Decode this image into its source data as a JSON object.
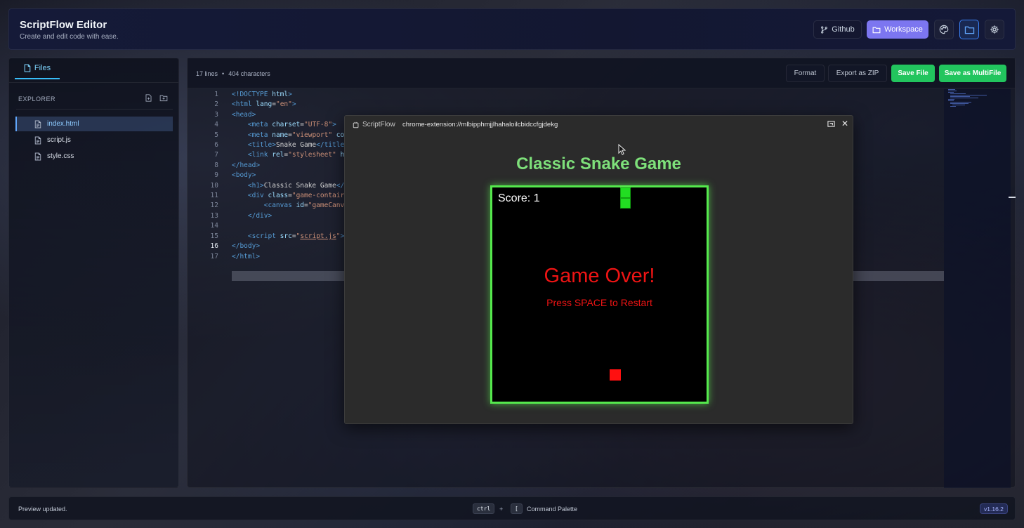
{
  "header": {
    "title": "ScriptFlow Editor",
    "subtitle": "Create and edit code with ease.",
    "github_label": "Github",
    "workspace_label": "Workspace",
    "accent_color": "#7c76f0"
  },
  "sidebar": {
    "tab_label": "Files",
    "explorer_label": "EXPLORER",
    "files": [
      {
        "name": "index.html",
        "active": true
      },
      {
        "name": "script.js",
        "active": false
      },
      {
        "name": "style.css",
        "active": false
      }
    ]
  },
  "editor": {
    "lines_stat": "17 lines",
    "chars_stat": "404 characters",
    "format_label": "Format",
    "export_label": "Export as ZIP",
    "save_label": "Save File",
    "save_multi_label": "Save as MultiFile",
    "current_line": 16,
    "line_numbers": [
      "1",
      "2",
      "3",
      "4",
      "5",
      "6",
      "7",
      "8",
      "9",
      "10",
      "11",
      "12",
      "13",
      "14",
      "15",
      "16",
      "17"
    ]
  },
  "preview": {
    "app_name": "ScriptFlow",
    "url": "chrome-extension://mlbipphmjjlhahaloilcbidccfgjdekg",
    "game_title": "Classic Snake Game",
    "score_text": "Score: 1",
    "game_over_text": "Game Over!",
    "restart_text": "Press SPACE to Restart",
    "board_color": "#55e94d",
    "snake_color": "#22dd22",
    "food_color": "#ff1010"
  },
  "status": {
    "message": "Preview updated.",
    "key1": "ctrl",
    "plus": "+",
    "key2": "[",
    "command_label": "Command Palette",
    "version": "v1.16.2"
  }
}
